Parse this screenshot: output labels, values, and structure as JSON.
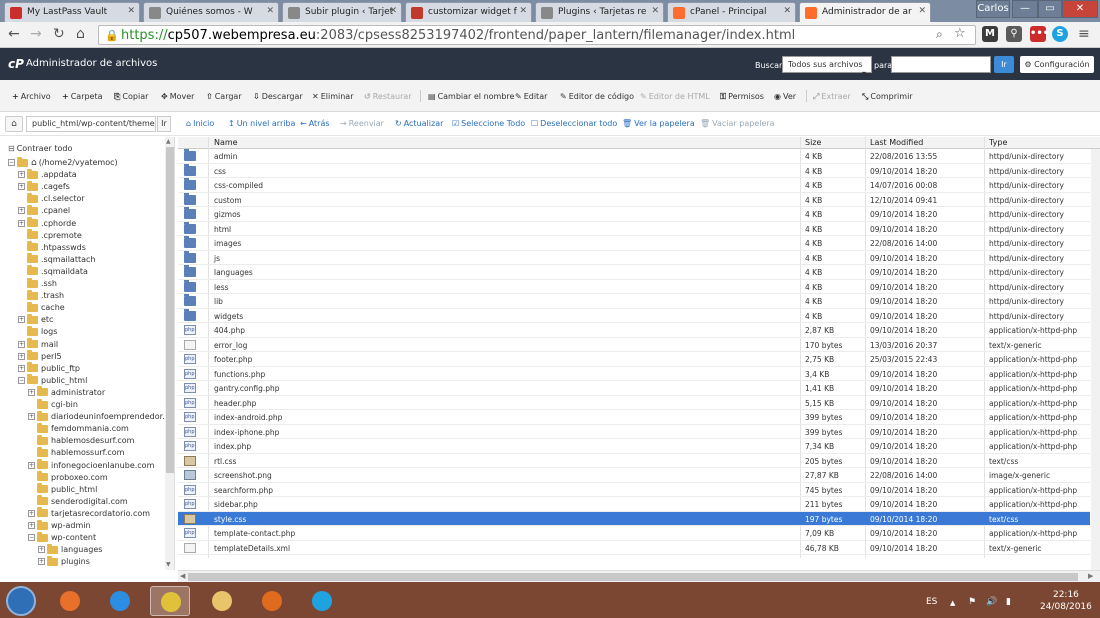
{
  "browser": {
    "tabs": [
      {
        "title": "My LastPass Vault",
        "favicon": "lastpass-icon",
        "color": "#cc2c2c",
        "active": false
      },
      {
        "title": "Quiénes somos - W",
        "favicon": "page-icon",
        "color": "#888888",
        "active": false
      },
      {
        "title": "Subir plugin ‹ Tarjet",
        "favicon": "page-icon",
        "color": "#888888",
        "active": false
      },
      {
        "title": "customizar widget f",
        "favicon": "w-icon",
        "color": "#c0392b",
        "active": false
      },
      {
        "title": "Plugins ‹ Tarjetas re",
        "favicon": "page-icon",
        "color": "#888888",
        "active": false
      },
      {
        "title": "cPanel - Principal",
        "favicon": "cpanel-icon",
        "color": "#ff6c2c",
        "active": false
      },
      {
        "title": "Administrador de ar",
        "favicon": "cpanel-icon",
        "color": "#ff6c2c",
        "active": true
      }
    ],
    "user_label": "Carlos",
    "url_scheme": "https://",
    "url_host": "cp507.webempresa.eu",
    "url_rest": ":2083/cpsess8253197402/frontend/paper_lantern/filemanager/index.html"
  },
  "header": {
    "title": "Administrador de archivos",
    "search_label": "Buscar",
    "search_scope": "Todos sus archivos",
    "search_for_label": "para",
    "search_value": "",
    "go_label": "Ir",
    "config_label": "Configuración"
  },
  "toolbar": [
    {
      "label": "Archivo",
      "icon": "+",
      "name": "new-file-button",
      "disabled": false
    },
    {
      "label": "Carpeta",
      "icon": "+",
      "name": "new-folder-button",
      "disabled": false
    },
    {
      "label": "Copiar",
      "icon": "⎘",
      "name": "copy-button",
      "disabled": false
    },
    {
      "label": "Mover",
      "icon": "✥",
      "name": "move-button",
      "disabled": false
    },
    {
      "label": "Cargar",
      "icon": "⇧",
      "name": "upload-button",
      "disabled": false
    },
    {
      "label": "Descargar",
      "icon": "⇩",
      "name": "download-button",
      "disabled": false
    },
    {
      "label": "Eliminar",
      "icon": "✕",
      "name": "delete-button",
      "disabled": false
    },
    {
      "label": "Restaurar",
      "icon": "↺",
      "name": "restore-button",
      "disabled": true
    },
    {
      "label": "Cambiar el nombre",
      "icon": "▤",
      "name": "rename-button",
      "disabled": false
    },
    {
      "label": "Editar",
      "icon": "✎",
      "name": "edit-button",
      "disabled": false
    },
    {
      "label": "Editor de código",
      "icon": "✎",
      "name": "code-editor-button",
      "disabled": false
    },
    {
      "label": "Editor de HTML",
      "icon": "✎",
      "name": "html-editor-button",
      "disabled": true
    },
    {
      "label": "Permisos",
      "icon": "⚿",
      "name": "permissions-button",
      "disabled": false
    },
    {
      "label": "Ver",
      "icon": "◉",
      "name": "view-button",
      "disabled": false
    },
    {
      "label": "Extraer",
      "icon": "⤢",
      "name": "extract-button",
      "disabled": true
    },
    {
      "label": "Comprimir",
      "icon": "⤡",
      "name": "compress-button",
      "disabled": false
    }
  ],
  "path": {
    "value": "public_html/wp-content/themes/",
    "go_label": "Ir"
  },
  "actions": [
    {
      "label": "Inicio",
      "icon": "⌂",
      "name": "home-link",
      "disabled": false
    },
    {
      "label": "Un nivel arriba",
      "icon": "↥",
      "name": "up-level-link",
      "disabled": false
    },
    {
      "label": "Atrás",
      "icon": "←",
      "name": "back-link",
      "disabled": false
    },
    {
      "label": "Reenviar",
      "icon": "→",
      "name": "forward-link",
      "disabled": true
    },
    {
      "label": "Actualizar",
      "icon": "↻",
      "name": "refresh-link",
      "disabled": false
    },
    {
      "label": "Seleccione Todo",
      "icon": "☑",
      "name": "select-all-link",
      "disabled": false
    },
    {
      "label": "Deseleccionar todo",
      "icon": "☐",
      "name": "deselect-all-link",
      "disabled": false
    },
    {
      "label": "Ver la papelera",
      "icon": "🗑",
      "name": "view-trash-link",
      "disabled": false
    },
    {
      "label": "Vaciar papelera",
      "icon": "🗑",
      "name": "empty-trash-link",
      "disabled": true
    }
  ],
  "sidebar": {
    "collapse_label": "Contraer todo",
    "tree": [
      {
        "label": "(/home2/vyatemoc)",
        "depth": 0,
        "expander": "−",
        "home": true
      },
      {
        "label": ".appdata",
        "depth": 1,
        "expander": "+"
      },
      {
        "label": ".cagefs",
        "depth": 1,
        "expander": "+"
      },
      {
        "label": ".cl.selector",
        "depth": 1,
        "expander": ""
      },
      {
        "label": ".cpanel",
        "depth": 1,
        "expander": "+"
      },
      {
        "label": ".cphorde",
        "depth": 1,
        "expander": "+"
      },
      {
        "label": ".cpremote",
        "depth": 1,
        "expander": ""
      },
      {
        "label": ".htpasswds",
        "depth": 1,
        "expander": ""
      },
      {
        "label": ".sqmailattach",
        "depth": 1,
        "expander": ""
      },
      {
        "label": ".sqmaildata",
        "depth": 1,
        "expander": ""
      },
      {
        "label": ".ssh",
        "depth": 1,
        "expander": ""
      },
      {
        "label": ".trash",
        "depth": 1,
        "expander": ""
      },
      {
        "label": "cache",
        "depth": 1,
        "expander": ""
      },
      {
        "label": "etc",
        "depth": 1,
        "expander": "+"
      },
      {
        "label": "logs",
        "depth": 1,
        "expander": ""
      },
      {
        "label": "mail",
        "depth": 1,
        "expander": "+"
      },
      {
        "label": "perl5",
        "depth": 1,
        "expander": "+"
      },
      {
        "label": "public_ftp",
        "depth": 1,
        "expander": "+"
      },
      {
        "label": "public_html",
        "depth": 1,
        "expander": "−"
      },
      {
        "label": "administrator",
        "depth": 2,
        "expander": "+"
      },
      {
        "label": "cgi-bin",
        "depth": 2,
        "expander": ""
      },
      {
        "label": "diariodeuninfoemprendedor.com",
        "depth": 2,
        "expander": "+"
      },
      {
        "label": "femdommania.com",
        "depth": 2,
        "expander": ""
      },
      {
        "label": "hablemosdesurf.com",
        "depth": 2,
        "expander": ""
      },
      {
        "label": "hablemossurf.com",
        "depth": 2,
        "expander": ""
      },
      {
        "label": "infonegocioenlanube.com",
        "depth": 2,
        "expander": "+"
      },
      {
        "label": "proboxeo.com",
        "depth": 2,
        "expander": ""
      },
      {
        "label": "public_html",
        "depth": 2,
        "expander": ""
      },
      {
        "label": "senderodigital.com",
        "depth": 2,
        "expander": ""
      },
      {
        "label": "tarjetasrecordatorio.com",
        "depth": 2,
        "expander": "+"
      },
      {
        "label": "wp-admin",
        "depth": 2,
        "expander": "+"
      },
      {
        "label": "wp-content",
        "depth": 2,
        "expander": "−"
      },
      {
        "label": "languages",
        "depth": 3,
        "expander": "+"
      },
      {
        "label": "plugins",
        "depth": 3,
        "expander": "+"
      }
    ]
  },
  "table": {
    "columns": {
      "name": "Name",
      "size": "Size",
      "modified": "Last Modified",
      "type": "Type"
    },
    "rows": [
      {
        "icon": "dir",
        "name": "admin",
        "size": "4 KB",
        "modified": "22/08/2016 13:55",
        "type": "httpd/unix-directory"
      },
      {
        "icon": "dir",
        "name": "css",
        "size": "4 KB",
        "modified": "09/10/2014 18:20",
        "type": "httpd/unix-directory"
      },
      {
        "icon": "dir",
        "name": "css-compiled",
        "size": "4 KB",
        "modified": "14/07/2016 00:08",
        "type": "httpd/unix-directory"
      },
      {
        "icon": "dir",
        "name": "custom",
        "size": "4 KB",
        "modified": "12/10/2014 09:41",
        "type": "httpd/unix-directory"
      },
      {
        "icon": "dir",
        "name": "gizmos",
        "size": "4 KB",
        "modified": "09/10/2014 18:20",
        "type": "httpd/unix-directory"
      },
      {
        "icon": "dir",
        "name": "html",
        "size": "4 KB",
        "modified": "09/10/2014 18:20",
        "type": "httpd/unix-directory"
      },
      {
        "icon": "dir",
        "name": "images",
        "size": "4 KB",
        "modified": "22/08/2016 14:00",
        "type": "httpd/unix-directory"
      },
      {
        "icon": "dir",
        "name": "js",
        "size": "4 KB",
        "modified": "09/10/2014 18:20",
        "type": "httpd/unix-directory"
      },
      {
        "icon": "dir",
        "name": "languages",
        "size": "4 KB",
        "modified": "09/10/2014 18:20",
        "type": "httpd/unix-directory"
      },
      {
        "icon": "dir",
        "name": "less",
        "size": "4 KB",
        "modified": "09/10/2014 18:20",
        "type": "httpd/unix-directory"
      },
      {
        "icon": "dir",
        "name": "lib",
        "size": "4 KB",
        "modified": "09/10/2014 18:20",
        "type": "httpd/unix-directory"
      },
      {
        "icon": "dir",
        "name": "widgets",
        "size": "4 KB",
        "modified": "09/10/2014 18:20",
        "type": "httpd/unix-directory"
      },
      {
        "icon": "php",
        "name": "404.php",
        "size": "2,87 KB",
        "modified": "09/10/2014 18:20",
        "type": "application/x-httpd-php"
      },
      {
        "icon": "txt",
        "name": "error_log",
        "size": "170 bytes",
        "modified": "13/03/2016 20:37",
        "type": "text/x-generic"
      },
      {
        "icon": "php",
        "name": "footer.php",
        "size": "2,75 KB",
        "modified": "25/03/2015 22:43",
        "type": "application/x-httpd-php"
      },
      {
        "icon": "php",
        "name": "functions.php",
        "size": "3,4 KB",
        "modified": "09/10/2014 18:20",
        "type": "application/x-httpd-php"
      },
      {
        "icon": "php",
        "name": "gantry.config.php",
        "size": "1,41 KB",
        "modified": "09/10/2014 18:20",
        "type": "application/x-httpd-php"
      },
      {
        "icon": "php",
        "name": "header.php",
        "size": "5,15 KB",
        "modified": "09/10/2014 18:20",
        "type": "application/x-httpd-php"
      },
      {
        "icon": "php",
        "name": "index-android.php",
        "size": "399 bytes",
        "modified": "09/10/2014 18:20",
        "type": "application/x-httpd-php"
      },
      {
        "icon": "php",
        "name": "index-iphone.php",
        "size": "399 bytes",
        "modified": "09/10/2014 18:20",
        "type": "application/x-httpd-php"
      },
      {
        "icon": "php",
        "name": "index.php",
        "size": "7,34 KB",
        "modified": "09/10/2014 18:20",
        "type": "application/x-httpd-php"
      },
      {
        "icon": "css",
        "name": "rtl.css",
        "size": "205 bytes",
        "modified": "09/10/2014 18:20",
        "type": "text/css"
      },
      {
        "icon": "img",
        "name": "screenshot.png",
        "size": "27,87 KB",
        "modified": "22/08/2016 14:00",
        "type": "image/x-generic"
      },
      {
        "icon": "php",
        "name": "searchform.php",
        "size": "745 bytes",
        "modified": "09/10/2014 18:20",
        "type": "application/x-httpd-php"
      },
      {
        "icon": "php",
        "name": "sidebar.php",
        "size": "211 bytes",
        "modified": "09/10/2014 18:20",
        "type": "application/x-httpd-php"
      },
      {
        "icon": "css",
        "name": "style.css",
        "size": "197 bytes",
        "modified": "09/10/2014 18:20",
        "type": "text/css",
        "selected": true
      },
      {
        "icon": "php",
        "name": "template-contact.php",
        "size": "7,09 KB",
        "modified": "09/10/2014 18:20",
        "type": "application/x-httpd-php"
      },
      {
        "icon": "txt",
        "name": "templateDetails.xml",
        "size": "46,78 KB",
        "modified": "09/10/2014 18:20",
        "type": "text/x-generic"
      }
    ]
  },
  "taskbar": {
    "apps": [
      {
        "name": "media-player-icon",
        "color": "#e8702a"
      },
      {
        "name": "internet-explorer-icon",
        "color": "#2b8ee3"
      },
      {
        "name": "chrome-icon",
        "color": "#e0c23a",
        "active": true
      },
      {
        "name": "file-explorer-icon",
        "color": "#e9c46a"
      },
      {
        "name": "firefox-icon",
        "color": "#e06b1f"
      },
      {
        "name": "skype-icon",
        "color": "#1fa3e0"
      }
    ],
    "language": "ES",
    "time": "22:16",
    "date": "24/08/2016"
  },
  "colors": {
    "accent": "#3a79d6",
    "header_bg": "#2a3443",
    "taskbar_bg": "#7c4732"
  }
}
